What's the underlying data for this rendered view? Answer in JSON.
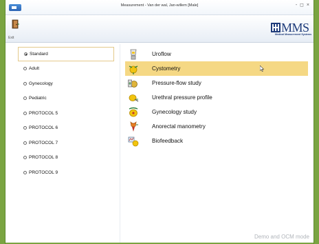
{
  "window": {
    "title": "Measurement - Van der wal, Jan-willem [Male]",
    "controls": "- ◻ ×"
  },
  "toolbar": {
    "exit_label": "Exit"
  },
  "logo": {
    "text": "MMS",
    "subtitle": "Medical Measurement Systems",
    "color": "#1e3b7a"
  },
  "protocols": {
    "items": [
      {
        "label": "Standard",
        "selected": true
      },
      {
        "label": "Adult",
        "selected": false
      },
      {
        "label": "Gynecology",
        "selected": false
      },
      {
        "label": "Pediatric",
        "selected": false
      },
      {
        "label": "PROTOCOL 5",
        "selected": false
      },
      {
        "label": "PROTOCOL 6",
        "selected": false
      },
      {
        "label": "PROTOCOL 7",
        "selected": false
      },
      {
        "label": "PROTOCOL 8",
        "selected": false
      },
      {
        "label": "PROTOCOL 9",
        "selected": false
      }
    ]
  },
  "studies": {
    "items": [
      {
        "label": "Uroflow",
        "icon": "uroflow-icon",
        "selected": false
      },
      {
        "label": "Cystometry",
        "icon": "cystometry-icon",
        "selected": true
      },
      {
        "label": "Pressure-flow study",
        "icon": "pressure-flow-icon",
        "selected": false
      },
      {
        "label": "Urethral pressure profile",
        "icon": "urethral-pressure-icon",
        "selected": false
      },
      {
        "label": "Gynecology study",
        "icon": "gynecology-icon",
        "selected": false
      },
      {
        "label": "Anorectal manometry",
        "icon": "anorectal-icon",
        "selected": false
      },
      {
        "label": "Biofeedback",
        "icon": "biofeedback-icon",
        "selected": false
      }
    ]
  },
  "status": {
    "mode_text": "Demo and OCM mode"
  },
  "colors": {
    "accent_green": "#7aa441",
    "selection": "#f5d884",
    "selection_border": "#e4c98a"
  }
}
